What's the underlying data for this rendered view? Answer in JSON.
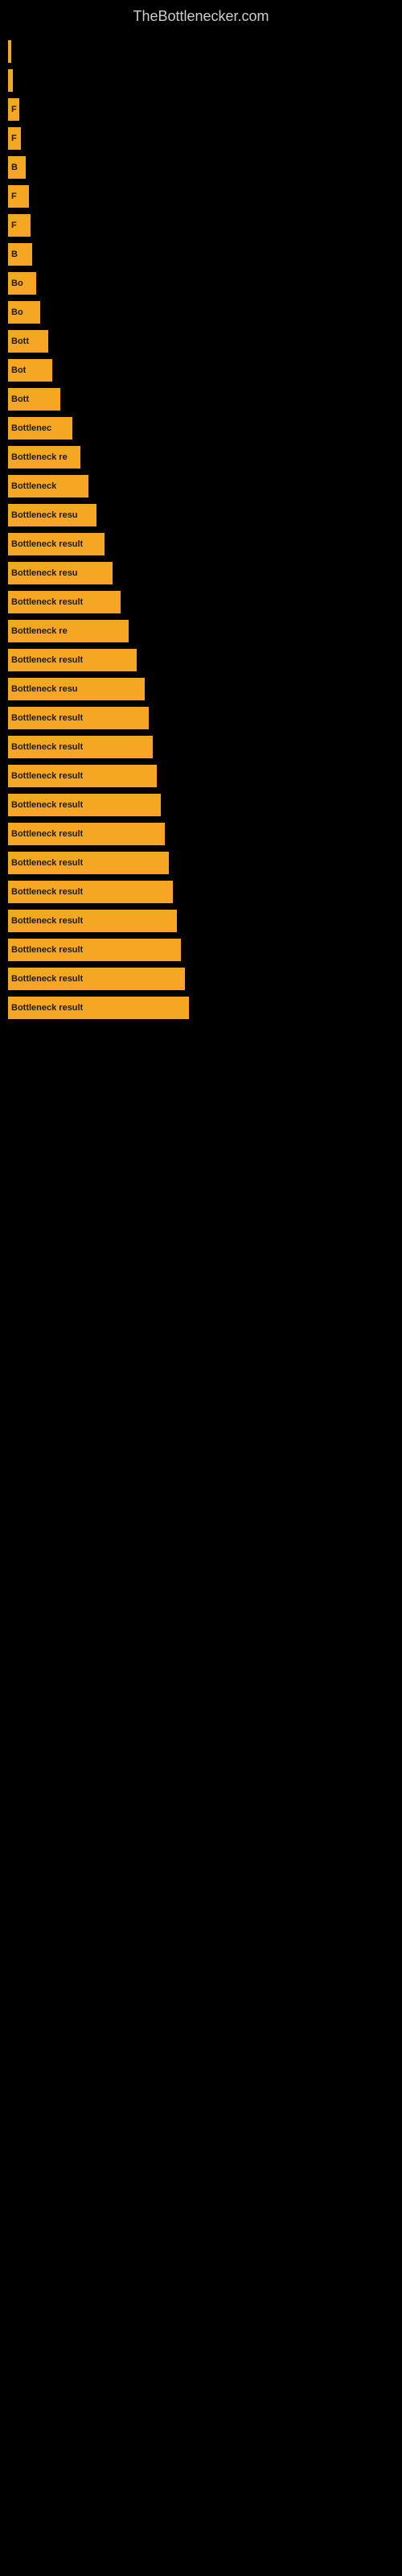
{
  "site": {
    "title": "TheBottlenecker.com"
  },
  "bars": [
    {
      "label": ""
    },
    {
      "label": ""
    },
    {
      "label": "F"
    },
    {
      "label": "F"
    },
    {
      "label": "B"
    },
    {
      "label": "F"
    },
    {
      "label": "F"
    },
    {
      "label": "B"
    },
    {
      "label": "Bo"
    },
    {
      "label": "Bo"
    },
    {
      "label": "Bott"
    },
    {
      "label": "Bot"
    },
    {
      "label": "Bott"
    },
    {
      "label": "Bottlenec"
    },
    {
      "label": "Bottleneck re"
    },
    {
      "label": "Bottleneck"
    },
    {
      "label": "Bottleneck resu"
    },
    {
      "label": "Bottleneck result"
    },
    {
      "label": "Bottleneck resu"
    },
    {
      "label": "Bottleneck result"
    },
    {
      "label": "Bottleneck re"
    },
    {
      "label": "Bottleneck result"
    },
    {
      "label": "Bottleneck resu"
    },
    {
      "label": "Bottleneck result"
    },
    {
      "label": "Bottleneck result"
    },
    {
      "label": "Bottleneck result"
    },
    {
      "label": "Bottleneck result"
    },
    {
      "label": "Bottleneck result"
    },
    {
      "label": "Bottleneck result"
    },
    {
      "label": "Bottleneck result"
    },
    {
      "label": "Bottleneck result"
    },
    {
      "label": "Bottleneck result"
    },
    {
      "label": "Bottleneck result"
    },
    {
      "label": "Bottleneck result"
    }
  ]
}
